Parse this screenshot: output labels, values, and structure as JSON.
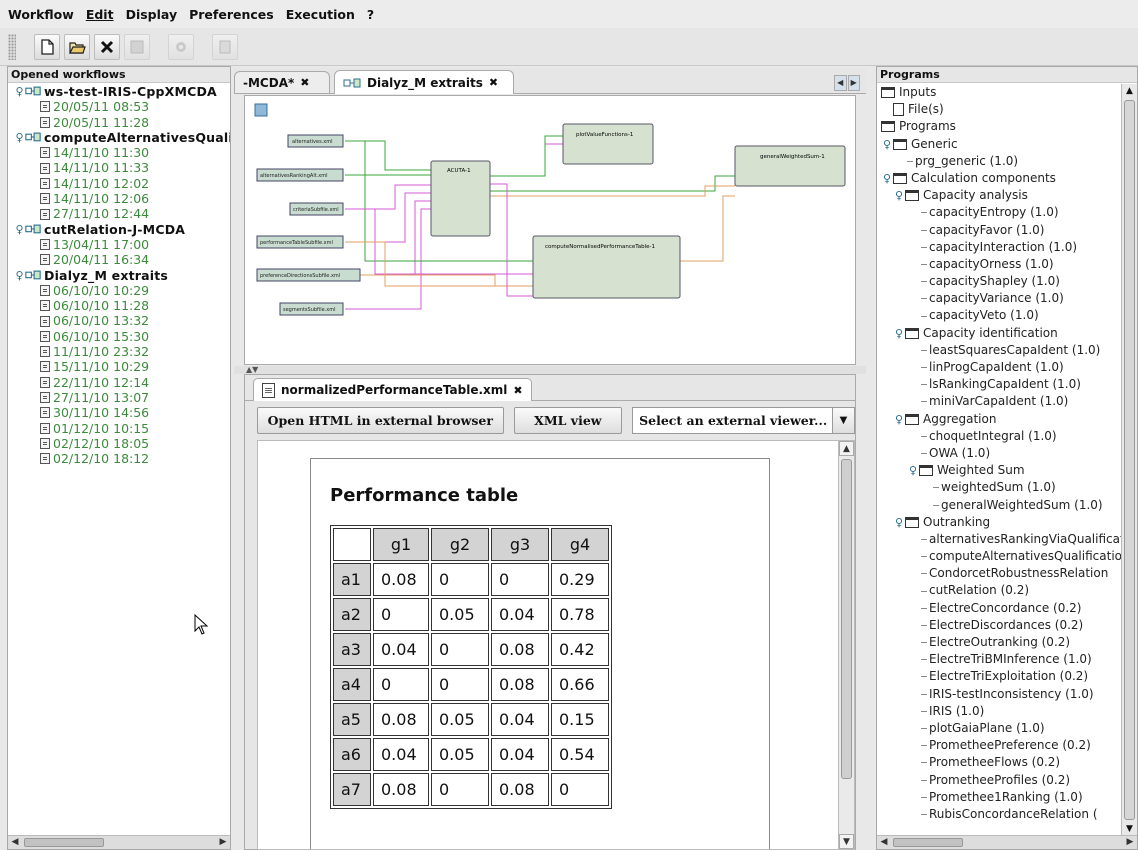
{
  "menu": [
    {
      "label": "Workflow"
    },
    {
      "label": "Edit"
    },
    {
      "label": "Display"
    },
    {
      "label": "Preferences"
    },
    {
      "label": "Execution"
    },
    {
      "label": "?"
    }
  ],
  "left_panel": {
    "title": "Opened workflows",
    "workflows": [
      {
        "name": "ws-test-IRIS-CppXMCDA",
        "runs": [
          "20/05/11 08:53",
          "20/05/11 11:28"
        ]
      },
      {
        "name": "computeAlternativesQualification",
        "runs": [
          "14/11/10 11:30",
          "14/11/10 11:33",
          "14/11/10 12:02",
          "14/11/10 12:06",
          "27/11/10 12:44"
        ]
      },
      {
        "name": "cutRelation-J-MCDA",
        "runs": [
          "13/04/11 17:00",
          "20/04/11 16:34"
        ]
      },
      {
        "name": "Dialyz_M extraits",
        "runs": [
          "06/10/10 10:29",
          "06/10/10 11:28",
          "06/10/10 13:32",
          "06/10/10 15:30",
          "11/11/10 23:32",
          "15/11/10 10:29",
          "22/11/10 12:14",
          "27/11/10 13:07",
          "30/11/10 14:56",
          "01/12/10 10:15",
          "02/12/10 18:05",
          "02/12/10 18:12"
        ]
      }
    ]
  },
  "editor_tabs": [
    {
      "label": "-MCDA*"
    },
    {
      "label": "Dialyz_M extraits"
    }
  ],
  "canvas": {
    "nodes": {
      "acuta": "ACUTA-1",
      "plot": "plotValueFunctions-1",
      "gws": "generalWeightedSum-1",
      "cnpt": "computeNormalisedPerformanceTable-1"
    },
    "inputs": [
      "alternatives.xml",
      "alternativesRankingAlt.xml",
      "criteriaSubfile.xml",
      "performanceTableSubfile.xml",
      "preferenceDirectionsSubfile.xml",
      "segmentsSubfile.xml"
    ]
  },
  "xml_tab": {
    "label": "normalizedPerformanceTable.xml"
  },
  "viewer": {
    "open_html": "Open HTML in external browser",
    "xml_view": "XML view",
    "select_viewer": "Select an external viewer..."
  },
  "performance": {
    "title": "Performance table",
    "columns": [
      "g1",
      "g2",
      "g3",
      "g4"
    ],
    "rows": [
      {
        "label": "a1",
        "values": [
          "0.08",
          "0",
          "0",
          "0.29"
        ]
      },
      {
        "label": "a2",
        "values": [
          "0",
          "0.05",
          "0.04",
          "0.78"
        ]
      },
      {
        "label": "a3",
        "values": [
          "0.04",
          "0",
          "0.08",
          "0.42"
        ]
      },
      {
        "label": "a4",
        "values": [
          "0",
          "0",
          "0.08",
          "0.66"
        ]
      },
      {
        "label": "a5",
        "values": [
          "0.08",
          "0.05",
          "0.04",
          "0.15"
        ]
      },
      {
        "label": "a6",
        "values": [
          "0.04",
          "0.05",
          "0.04",
          "0.54"
        ]
      },
      {
        "label": "a7",
        "values": [
          "0.08",
          "0",
          "0.08",
          "0"
        ]
      }
    ]
  },
  "right_panel": {
    "title": "Programs",
    "items": [
      {
        "label": "Inputs",
        "type": "folder",
        "depth": 0,
        "toggle": ""
      },
      {
        "label": "File(s)",
        "type": "file",
        "depth": 1,
        "toggle": ""
      },
      {
        "label": "Programs",
        "type": "folder",
        "depth": 0,
        "toggle": ""
      },
      {
        "label": "Generic",
        "type": "folder",
        "depth": 0,
        "toggle": "open"
      },
      {
        "label": "prg_generic (1.0)",
        "type": "leaf",
        "depth": 2,
        "toggle": ""
      },
      {
        "label": "Calculation components",
        "type": "folder",
        "depth": 0,
        "toggle": "open"
      },
      {
        "label": "Capacity analysis",
        "type": "folder",
        "depth": 1,
        "toggle": "open"
      },
      {
        "label": "capacityEntropy (1.0)",
        "type": "leaf",
        "depth": 3,
        "toggle": ""
      },
      {
        "label": "capacityFavor (1.0)",
        "type": "leaf",
        "depth": 3,
        "toggle": ""
      },
      {
        "label": "capacityInteraction (1.0)",
        "type": "leaf",
        "depth": 3,
        "toggle": ""
      },
      {
        "label": "capacityOrness (1.0)",
        "type": "leaf",
        "depth": 3,
        "toggle": ""
      },
      {
        "label": "capacityShapley (1.0)",
        "type": "leaf",
        "depth": 3,
        "toggle": ""
      },
      {
        "label": "capacityVariance (1.0)",
        "type": "leaf",
        "depth": 3,
        "toggle": ""
      },
      {
        "label": "capacityVeto (1.0)",
        "type": "leaf",
        "depth": 3,
        "toggle": ""
      },
      {
        "label": "Capacity identification",
        "type": "folder",
        "depth": 1,
        "toggle": "open"
      },
      {
        "label": "leastSquaresCapaIdent (1.0)",
        "type": "leaf",
        "depth": 3,
        "toggle": ""
      },
      {
        "label": "linProgCapaIdent (1.0)",
        "type": "leaf",
        "depth": 3,
        "toggle": ""
      },
      {
        "label": "lsRankingCapaIdent (1.0)",
        "type": "leaf",
        "depth": 3,
        "toggle": ""
      },
      {
        "label": "miniVarCapaIdent (1.0)",
        "type": "leaf",
        "depth": 3,
        "toggle": ""
      },
      {
        "label": "Aggregation",
        "type": "folder",
        "depth": 1,
        "toggle": "open"
      },
      {
        "label": "choquetIntegral (1.0)",
        "type": "leaf",
        "depth": 3,
        "toggle": ""
      },
      {
        "label": "OWA (1.0)",
        "type": "leaf",
        "depth": 3,
        "toggle": ""
      },
      {
        "label": "Weighted Sum",
        "type": "folder",
        "depth": 2,
        "toggle": "open"
      },
      {
        "label": "weightedSum (1.0)",
        "type": "leaf",
        "depth": 4,
        "toggle": ""
      },
      {
        "label": "generalWeightedSum (1.0)",
        "type": "leaf",
        "depth": 4,
        "toggle": ""
      },
      {
        "label": "Outranking",
        "type": "folder",
        "depth": 1,
        "toggle": "open"
      },
      {
        "label": "alternativesRankingViaQualification",
        "type": "leaf",
        "depth": 3,
        "toggle": ""
      },
      {
        "label": "computeAlternativesQualification",
        "type": "leaf",
        "depth": 3,
        "toggle": ""
      },
      {
        "label": "CondorcetRobustnessRelation",
        "type": "leaf",
        "depth": 3,
        "toggle": ""
      },
      {
        "label": "cutRelation (0.2)",
        "type": "leaf",
        "depth": 3,
        "toggle": ""
      },
      {
        "label": "ElectreConcordance (0.2)",
        "type": "leaf",
        "depth": 3,
        "toggle": ""
      },
      {
        "label": "ElectreDiscordances (0.2)",
        "type": "leaf",
        "depth": 3,
        "toggle": ""
      },
      {
        "label": "ElectreOutranking (0.2)",
        "type": "leaf",
        "depth": 3,
        "toggle": ""
      },
      {
        "label": "ElectreTriBMInference (1.0)",
        "type": "leaf",
        "depth": 3,
        "toggle": ""
      },
      {
        "label": "ElectreTriExploitation (0.2)",
        "type": "leaf",
        "depth": 3,
        "toggle": ""
      },
      {
        "label": "IRIS-testInconsistency (1.0)",
        "type": "leaf",
        "depth": 3,
        "toggle": ""
      },
      {
        "label": "IRIS (1.0)",
        "type": "leaf",
        "depth": 3,
        "toggle": ""
      },
      {
        "label": "plotGaiaPlane (1.0)",
        "type": "leaf",
        "depth": 3,
        "toggle": ""
      },
      {
        "label": "PrometheePreference (0.2)",
        "type": "leaf",
        "depth": 3,
        "toggle": ""
      },
      {
        "label": "PrometheeFlows (0.2)",
        "type": "leaf",
        "depth": 3,
        "toggle": ""
      },
      {
        "label": "PrometheeProfiles (0.2)",
        "type": "leaf",
        "depth": 3,
        "toggle": ""
      },
      {
        "label": "Promethee1Ranking (1.0)",
        "type": "leaf",
        "depth": 3,
        "toggle": ""
      },
      {
        "label": "RubisConcordanceRelation (",
        "type": "leaf",
        "depth": 3,
        "toggle": ""
      }
    ]
  }
}
